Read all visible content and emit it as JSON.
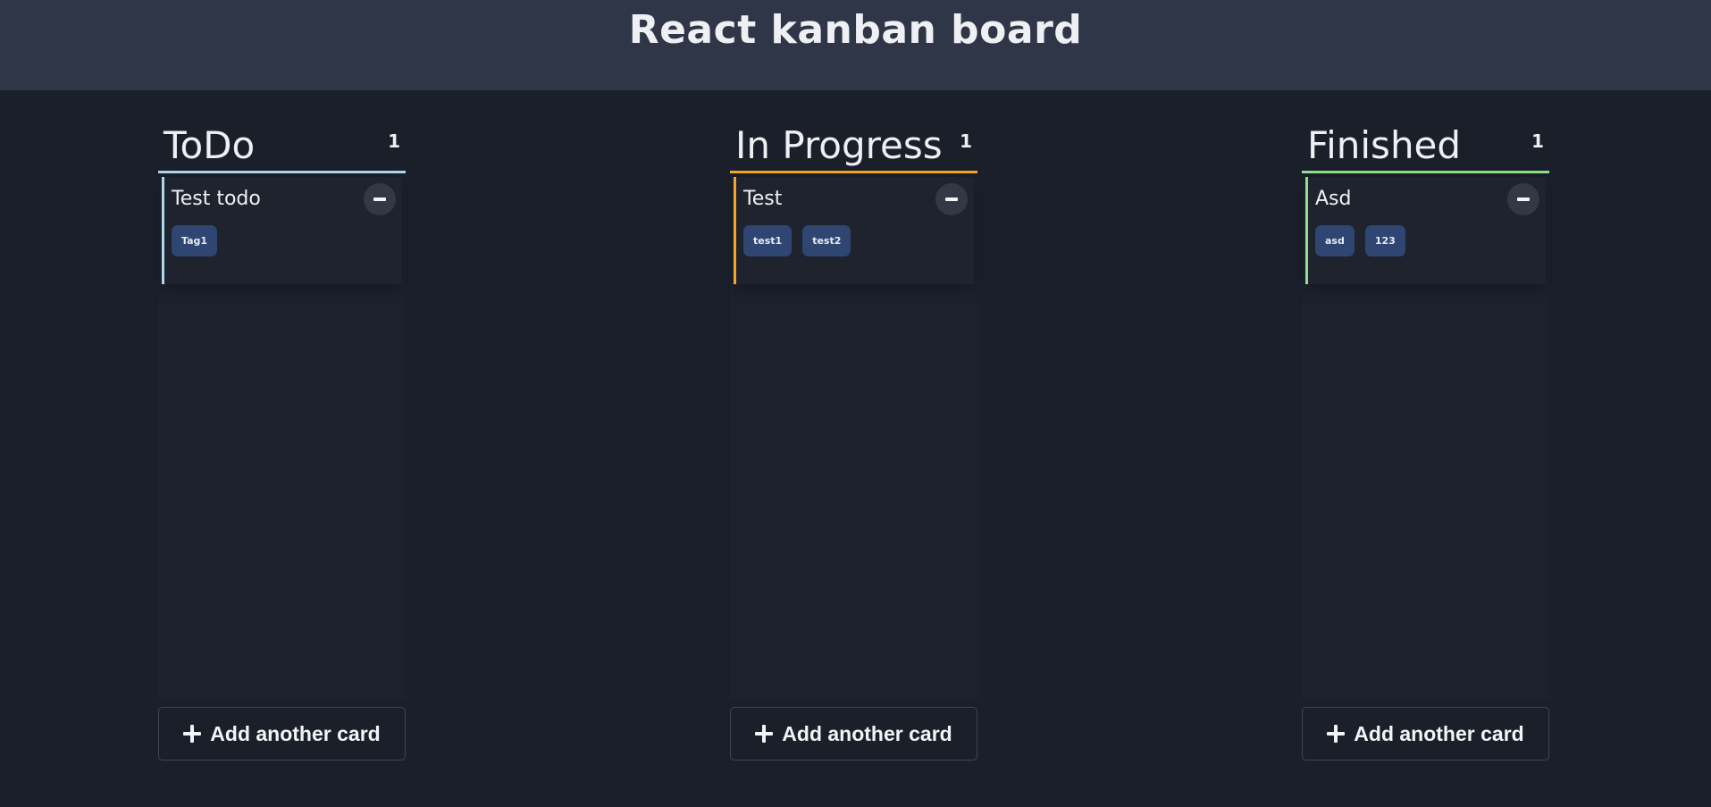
{
  "header": {
    "title": "React kanban board"
  },
  "columns": [
    {
      "title": "ToDo",
      "count": "1",
      "accent": "#aad8ee",
      "cards": [
        {
          "title": "Test todo",
          "tags": [
            "Tag1"
          ]
        }
      ],
      "add_label": "Add another card"
    },
    {
      "title": "In Progress",
      "count": "1",
      "accent": "#f5a623",
      "cards": [
        {
          "title": "Test",
          "tags": [
            "test1",
            "test2"
          ]
        }
      ],
      "add_label": "Add another card"
    },
    {
      "title": "Finished",
      "count": "1",
      "accent": "#8ee08a",
      "cards": [
        {
          "title": "Asd",
          "tags": [
            "asd",
            "123"
          ]
        }
      ],
      "add_label": "Add another card"
    }
  ]
}
